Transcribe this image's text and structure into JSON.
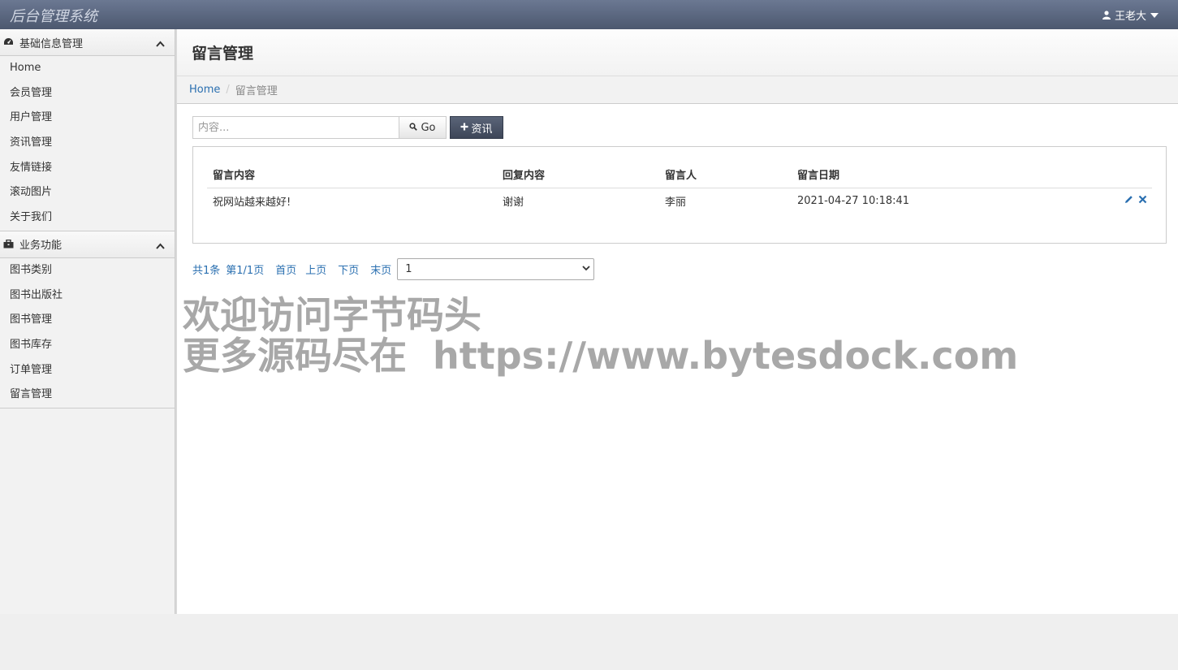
{
  "app": {
    "brand": "后台管理系统",
    "user_name": "王老大"
  },
  "sidebar": {
    "groups": [
      {
        "title": "基础信息管理",
        "items": [
          "Home",
          "会员管理",
          "用户管理",
          "资讯管理",
          "友情链接",
          "滚动图片",
          "关于我们"
        ]
      },
      {
        "title": "业务功能",
        "items": [
          "图书类别",
          "图书出版社",
          "图书管理",
          "图书库存",
          "订单管理",
          "留言管理"
        ]
      }
    ]
  },
  "page": {
    "title": "留言管理"
  },
  "breadcrumb": {
    "home": "Home",
    "current": "留言管理"
  },
  "toolbar": {
    "search_placeholder": "内容...",
    "go_label": "Go",
    "add_label": "资讯"
  },
  "table": {
    "headers": [
      "留言内容",
      "回复内容",
      "留言人",
      "留言日期"
    ],
    "rows": [
      {
        "content": "祝网站越来越好!",
        "reply": "谢谢",
        "author": "李丽",
        "date": "2021-04-27 10:18:41"
      }
    ]
  },
  "pager": {
    "total": "共1条",
    "page_info": "第1/1页",
    "first": "首页",
    "prev": "上页",
    "next": "下页",
    "last": "末页",
    "selected": "1"
  },
  "watermark": {
    "line1": "欢迎访问字节码头",
    "line2": "更多源码尽在  https://www.bytesdock.com"
  },
  "colors": {
    "navbar": "#5a6680",
    "link": "#2a6fb0",
    "add_button": "#4a5366"
  }
}
